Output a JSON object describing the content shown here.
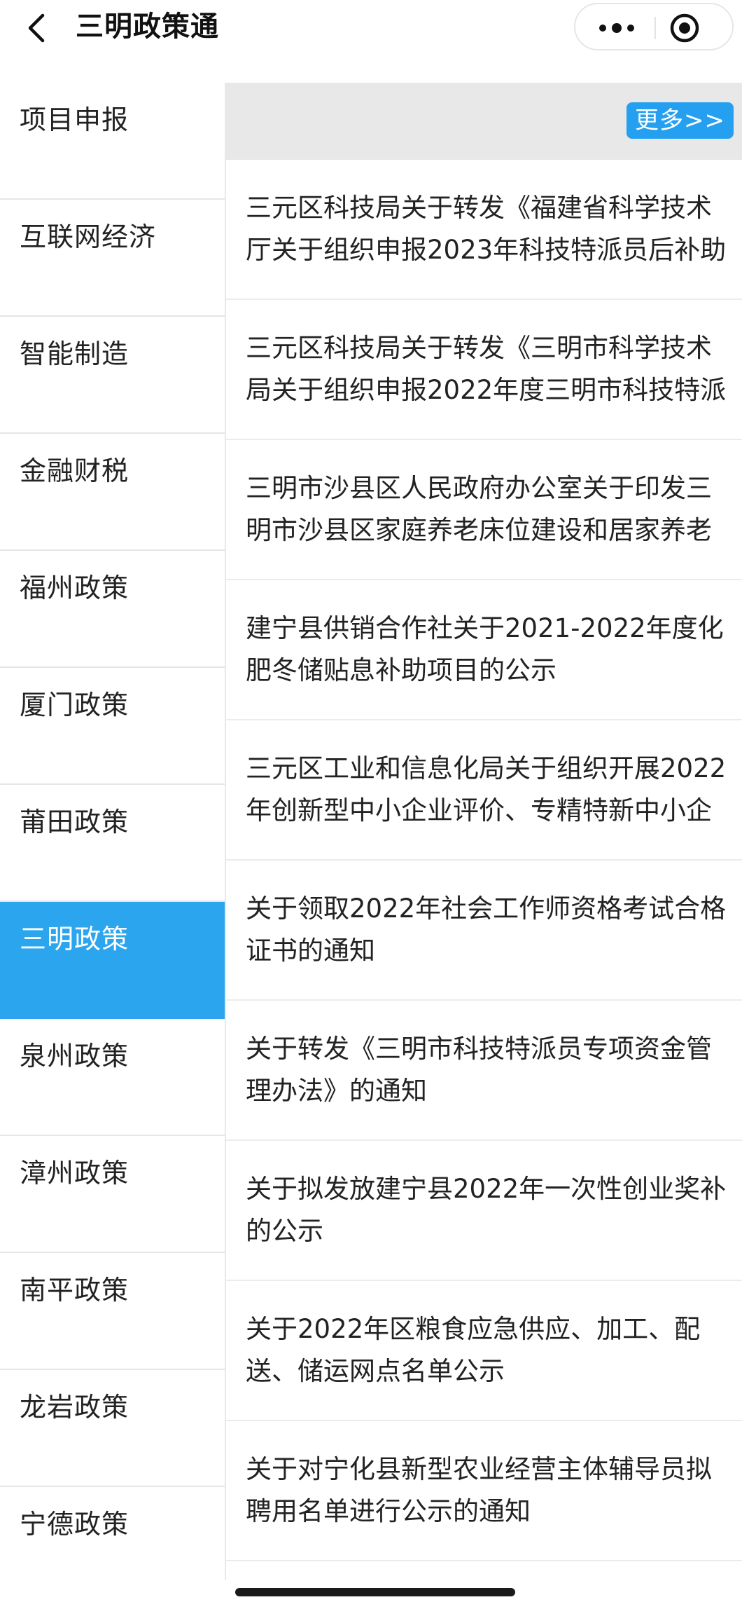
{
  "header": {
    "title": "三明政策通",
    "back_icon": "chevron-left-icon",
    "more_icon": "more-dots-icon",
    "close_icon": "target-circle-icon"
  },
  "sidebar": {
    "active_index": 7,
    "active_color": "#2aa5ee",
    "items": [
      {
        "label": "项目申报"
      },
      {
        "label": "互联网经济"
      },
      {
        "label": "智能制造"
      },
      {
        "label": "金融财税"
      },
      {
        "label": "福州政策"
      },
      {
        "label": "厦门政策"
      },
      {
        "label": "莆田政策"
      },
      {
        "label": "三明政策"
      },
      {
        "label": "泉州政策"
      },
      {
        "label": "漳州政策"
      },
      {
        "label": "南平政策"
      },
      {
        "label": "龙岩政策"
      },
      {
        "label": "宁德政策"
      }
    ]
  },
  "content": {
    "more_label": "更多>>",
    "more_color": "#259ff0",
    "items": [
      {
        "title": "三元区科技局关于转发《福建省科学技术厅关于组织申报2023年科技特派员后补助"
      },
      {
        "title": "三元区科技局关于转发《三明市科学技术局关于组织申报2022年度三明市科技特派"
      },
      {
        "title": "三明市沙县区人民政府办公室关于印发三明市沙县区家庭养老床位建设和居家养老"
      },
      {
        "title": "建宁县供销合作社关于2021-2022年度化肥冬储贴息补助项目的公示"
      },
      {
        "title": "三元区工业和信息化局关于组织开展2022年创新型中小企业评价、专精特新中小企"
      },
      {
        "title": "关于领取2022年社会工作师资格考试合格证书的通知"
      },
      {
        "title": "关于转发《三明市科技特派员专项资金管理办法》的通知"
      },
      {
        "title": "关于拟发放建宁县2022年一次性创业奖补的公示"
      },
      {
        "title": "关于2022年区粮食应急供应、加工、配送、储运网点名单公示"
      },
      {
        "title": "关于对宁化县新型农业经营主体辅导员拟聘用名单进行公示的通知"
      }
    ]
  }
}
